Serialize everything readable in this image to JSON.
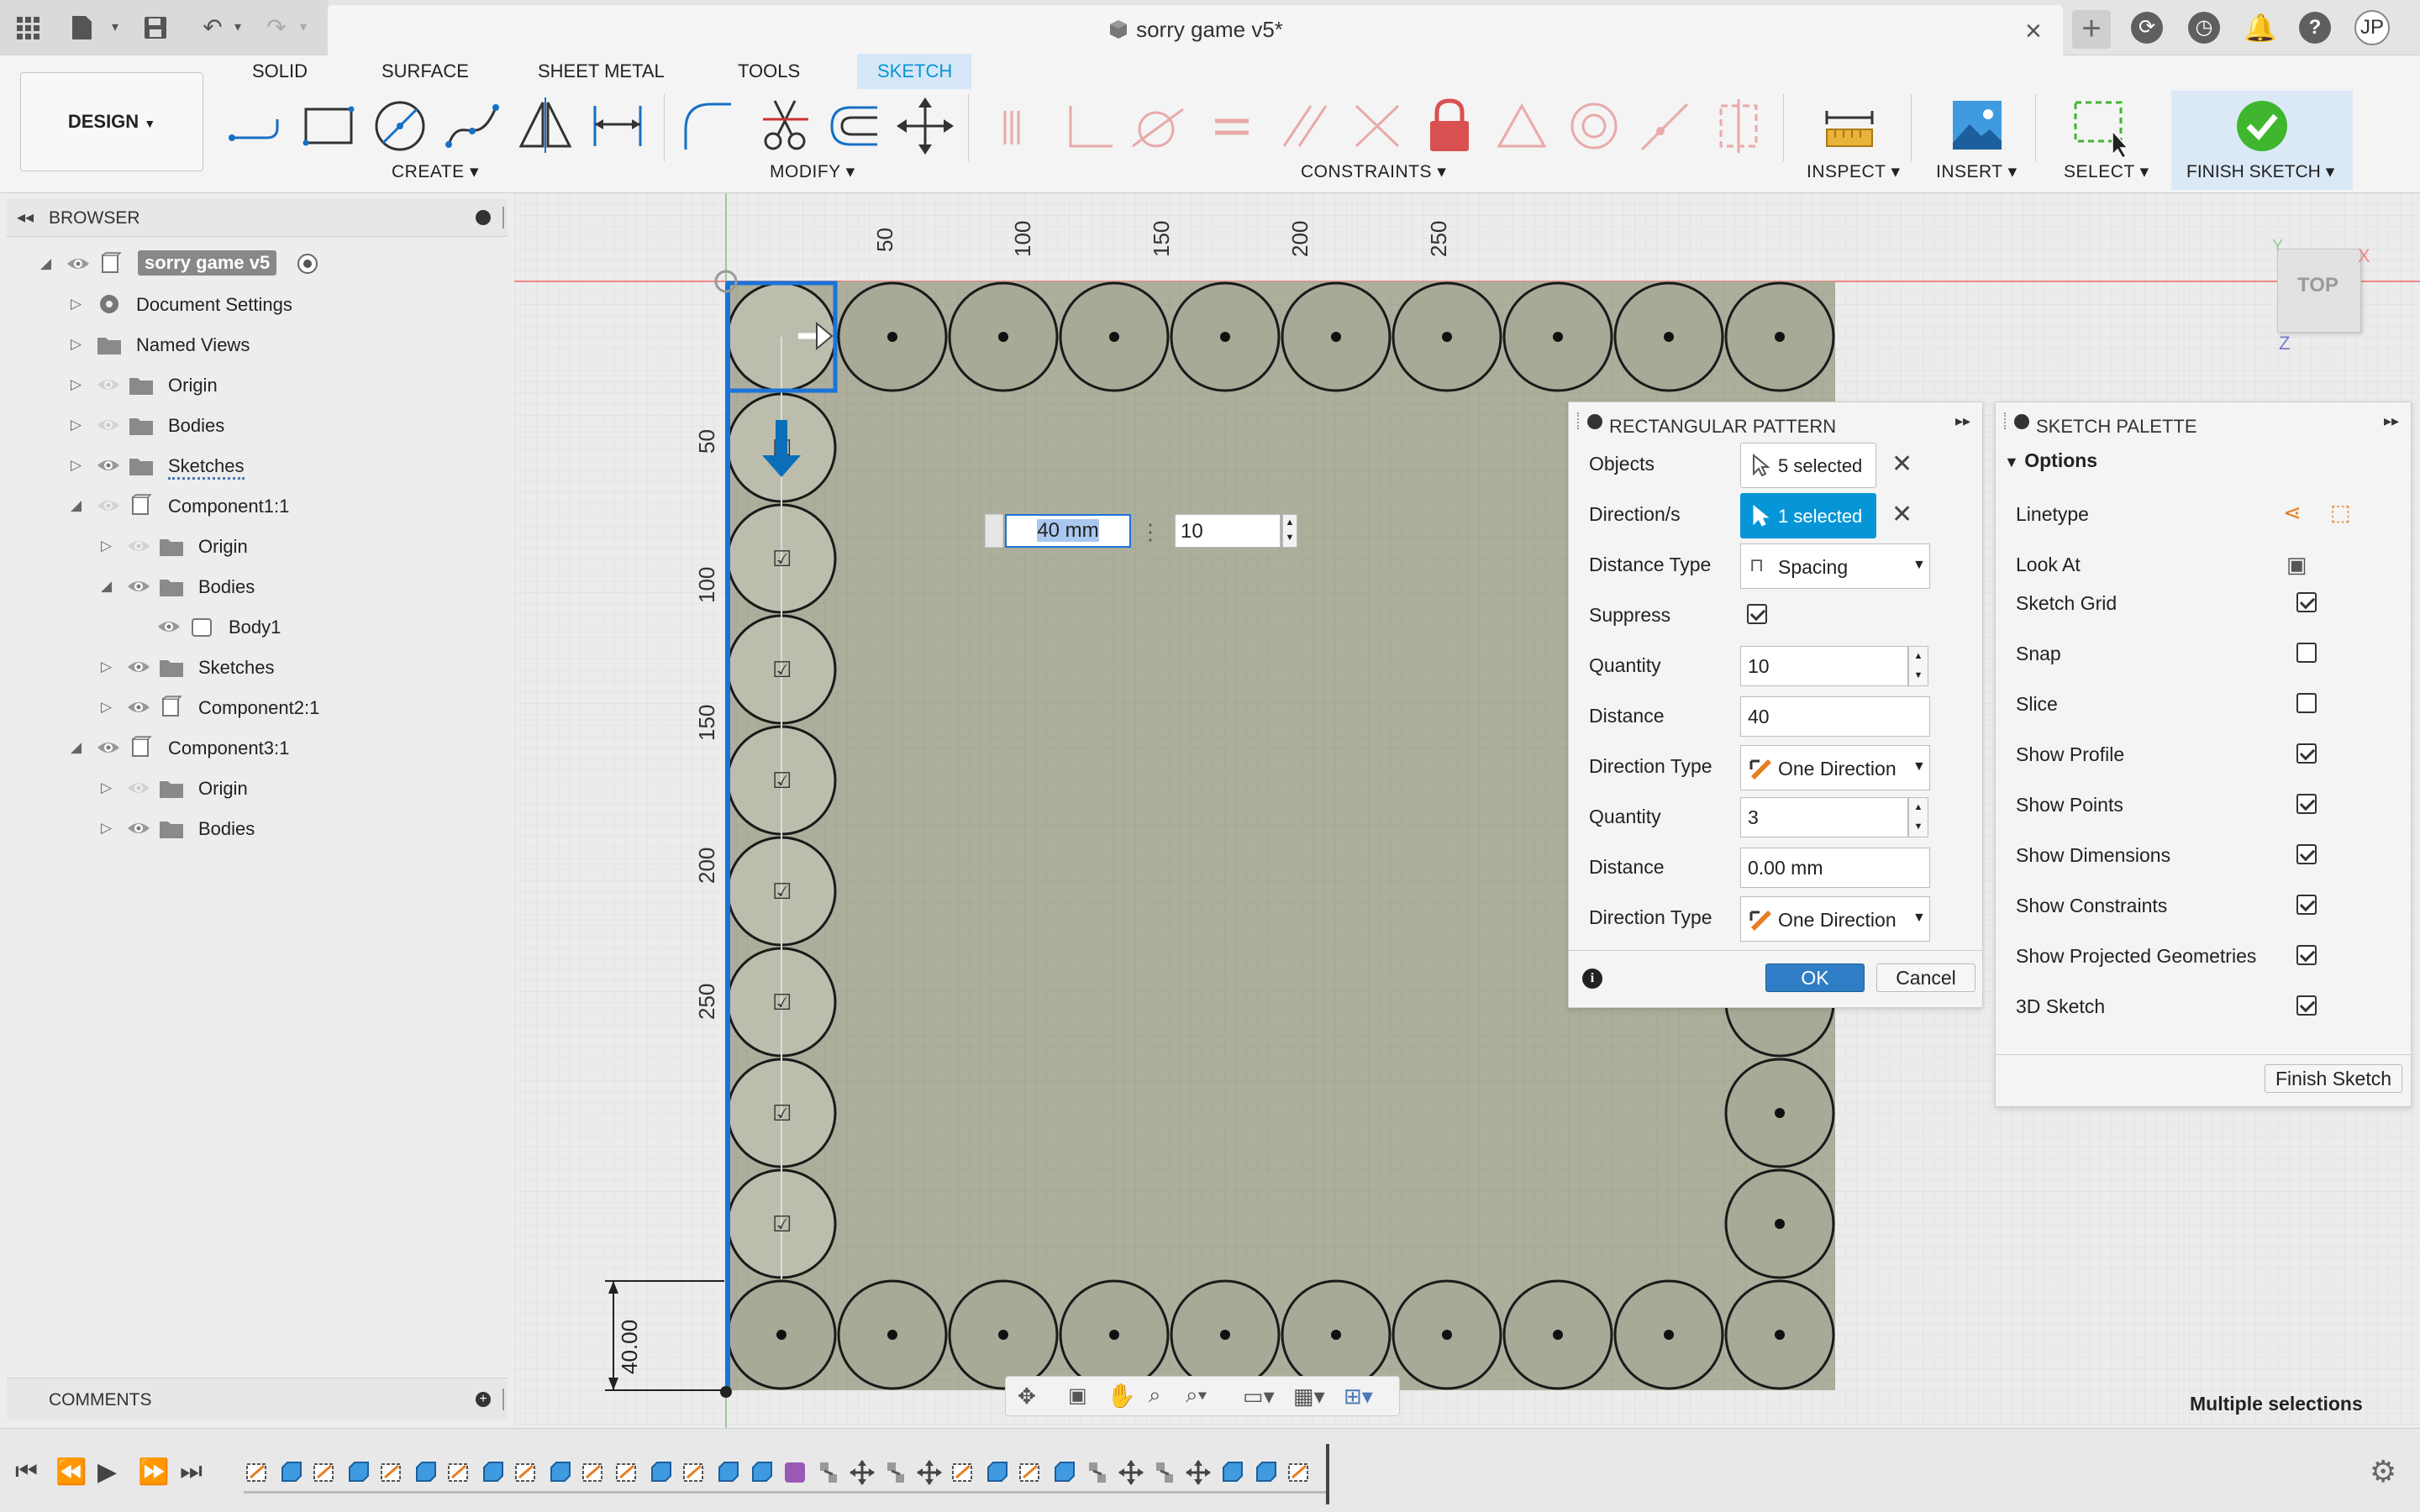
{
  "window": {
    "title": "sorry game v5*",
    "user_initials": "JP"
  },
  "ribbon": {
    "workspace": "DESIGN",
    "tabs": [
      "SOLID",
      "SURFACE",
      "SHEET METAL",
      "TOOLS",
      "SKETCH"
    ],
    "active_tab": "SKETCH",
    "groups": {
      "create": "CREATE",
      "modify": "MODIFY",
      "constraints": "CONSTRAINTS",
      "inspect": "INSPECT",
      "insert": "INSERT",
      "select": "SELECT",
      "finish": "FINISH SKETCH"
    }
  },
  "browser": {
    "title": "BROWSER",
    "items": [
      {
        "label": "sorry game v5",
        "depth": 0,
        "expanded": true,
        "visible": true
      },
      {
        "label": "Document Settings",
        "depth": 1,
        "expanded": false,
        "icon": "gear-icon"
      },
      {
        "label": "Named Views",
        "depth": 1,
        "expanded": false,
        "icon": "folder-icon"
      },
      {
        "label": "Origin",
        "depth": 1,
        "expanded": false,
        "visible": false,
        "icon": "folder-icon"
      },
      {
        "label": "Bodies",
        "depth": 1,
        "expanded": false,
        "visible": false,
        "icon": "folder-icon"
      },
      {
        "label": "Sketches",
        "depth": 1,
        "expanded": false,
        "visible": true,
        "icon": "folder-icon"
      },
      {
        "label": "Component1:1",
        "depth": 1,
        "expanded": true,
        "visible": false,
        "icon": "component-icon"
      },
      {
        "label": "Origin",
        "depth": 2,
        "expanded": false,
        "visible": false,
        "icon": "folder-icon"
      },
      {
        "label": "Bodies",
        "depth": 2,
        "expanded": true,
        "visible": true,
        "icon": "folder-icon"
      },
      {
        "label": "Body1",
        "depth": 3,
        "visible": true,
        "icon": "body-icon"
      },
      {
        "label": "Sketches",
        "depth": 2,
        "expanded": false,
        "visible": true,
        "icon": "folder-icon"
      },
      {
        "label": "Component2:1",
        "depth": 2,
        "expanded": false,
        "visible": true,
        "icon": "component-icon"
      },
      {
        "label": "Component3:1",
        "depth": 1,
        "expanded": true,
        "visible": true,
        "icon": "component-icon"
      },
      {
        "label": "Origin",
        "depth": 2,
        "expanded": false,
        "visible": false,
        "icon": "folder-icon"
      },
      {
        "label": "Bodies",
        "depth": 2,
        "expanded": false,
        "visible": true,
        "icon": "folder-icon"
      }
    ]
  },
  "comments": {
    "title": "COMMENTS"
  },
  "canvas": {
    "ruler_top": [
      "50",
      "100",
      "150",
      "200",
      "250"
    ],
    "ruler_left": [
      "50",
      "100",
      "150",
      "200",
      "250"
    ],
    "dimension_label": "40.00",
    "inline_input": {
      "distance": "40 mm",
      "quantity": "10"
    },
    "viewcube": {
      "face": "TOP",
      "axis_x": "X",
      "axis_y": "Y",
      "axis_z": "Z"
    },
    "status": "Multiple selections"
  },
  "rect_pattern": {
    "title": "RECTANGULAR PATTERN",
    "rows": {
      "objects_label": "Objects",
      "objects_value": "5 selected",
      "direction_label": "Direction/s",
      "direction_value": "1 selected",
      "distance_type_label": "Distance Type",
      "distance_type_value": "Spacing",
      "suppress_label": "Suppress",
      "quantity1_label": "Quantity",
      "quantity1_value": "10",
      "distance1_label": "Distance",
      "distance1_value": "40",
      "direction_type1_label": "Direction Type",
      "direction_type1_value": "One Direction",
      "quantity2_label": "Quantity",
      "quantity2_value": "3",
      "distance2_label": "Distance",
      "distance2_value": "0.00 mm",
      "direction_type2_label": "Direction Type",
      "direction_type2_value": "One Direction"
    },
    "ok": "OK",
    "cancel": "Cancel"
  },
  "sketch_palette": {
    "title": "SKETCH PALETTE",
    "section": "Options",
    "linetype": "Linetype",
    "look_at": "Look At",
    "options": [
      {
        "label": "Sketch Grid",
        "checked": true
      },
      {
        "label": "Snap",
        "checked": false
      },
      {
        "label": "Slice",
        "checked": false
      },
      {
        "label": "Show Profile",
        "checked": true
      },
      {
        "label": "Show Points",
        "checked": true
      },
      {
        "label": "Show Dimensions",
        "checked": true
      },
      {
        "label": "Show Constraints",
        "checked": true
      },
      {
        "label": "Show Projected Geometries",
        "checked": true
      },
      {
        "label": "3D Sketch",
        "checked": true
      }
    ],
    "finish_button": "Finish Sketch"
  },
  "colors": {
    "accent": "#0696d7",
    "selection": "#1a73d9",
    "finish_green": "#3fb62e",
    "board": "#aeae9c"
  }
}
